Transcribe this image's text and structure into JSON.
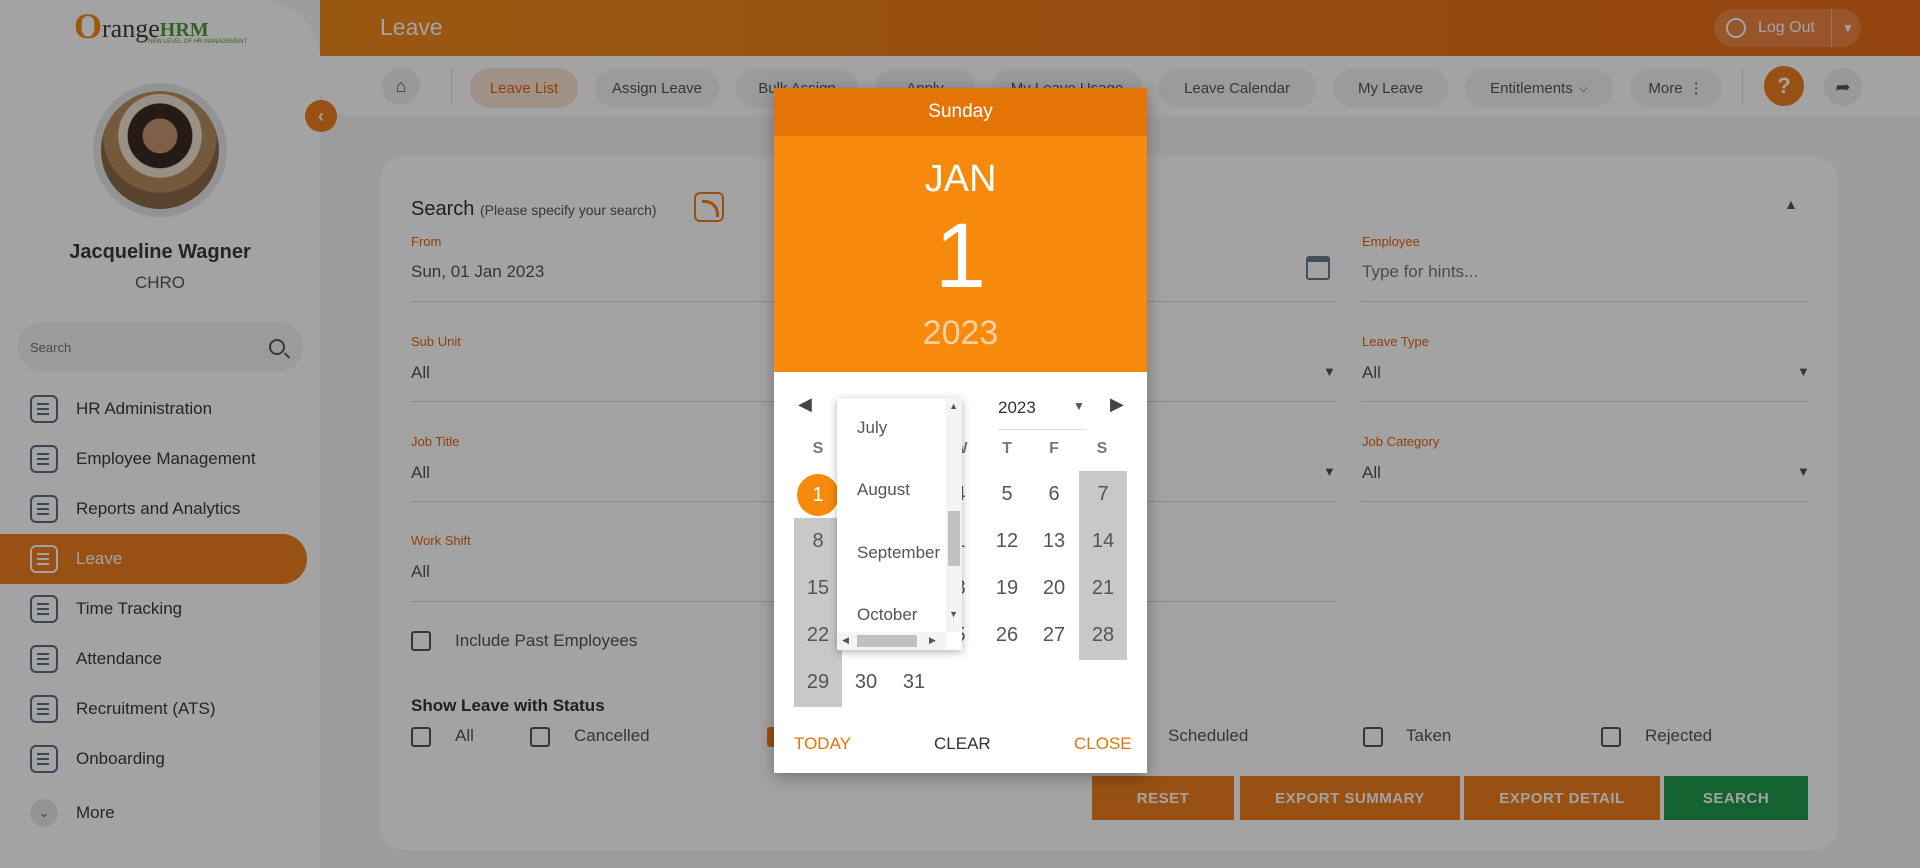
{
  "app": {
    "logo_o": "O",
    "logo_range": "range",
    "logo_hrm": "HRM",
    "logo_tagline": "NEW LEVEL OF HR MANAGEMENT",
    "page_title": "Leave",
    "logout_label": "Log Out",
    "brand_color": "#ef7d1f"
  },
  "user": {
    "name": "Jacqueline Wagner",
    "role": "CHRO"
  },
  "sidebar": {
    "search_placeholder": "Search",
    "items": [
      {
        "label": "HR Administration",
        "icon": "hr-admin-icon"
      },
      {
        "label": "Employee Management",
        "icon": "employees-icon"
      },
      {
        "label": "Reports and Analytics",
        "icon": "reports-icon"
      },
      {
        "label": "Leave",
        "icon": "leave-icon",
        "active": true
      },
      {
        "label": "Time Tracking",
        "icon": "clock-icon"
      },
      {
        "label": "Attendance",
        "icon": "attendance-icon"
      },
      {
        "label": "Recruitment (ATS)",
        "icon": "recruitment-icon"
      },
      {
        "label": "Onboarding",
        "icon": "handshake-icon"
      }
    ],
    "more_label": "More"
  },
  "nav": {
    "tabs": [
      {
        "label": "Leave List",
        "active": true
      },
      {
        "label": "Assign Leave"
      },
      {
        "label": "Bulk Assign"
      },
      {
        "label": "Apply"
      },
      {
        "label": "My Leave Usage"
      },
      {
        "label": "Leave Calendar"
      },
      {
        "label": "My Leave"
      },
      {
        "label": "Entitlements"
      },
      {
        "label": "More"
      }
    ],
    "help_label": "?"
  },
  "search": {
    "title": "Search",
    "subtitle": "(Please specify your search)",
    "from_label": "From",
    "from_value": "Sun, 01 Jan 2023",
    "employee_label": "Employee",
    "employee_placeholder": "Type for hints...",
    "subunit_label": "Sub Unit",
    "subunit_value": "All",
    "leave_type_label": "Leave Type",
    "leave_type_value": "All",
    "job_title_label": "Job Title",
    "job_title_value": "All",
    "job_category_label": "Job Category",
    "job_category_value": "All",
    "work_shift_label": "Work Shift",
    "work_shift_value": "All",
    "include_past_label": "Include Past Employees",
    "status_title": "Show Leave with Status",
    "statuses": [
      "All",
      "Cancelled",
      "Scheduled",
      "Taken",
      "Rejected"
    ]
  },
  "buttons": {
    "reset": "RESET",
    "export_summary": "EXPORT SUMMARY",
    "export_detail": "EXPORT DETAIL",
    "search": "SEARCH",
    "search_color": "#1e9a4a"
  },
  "datepicker": {
    "weekday": "Sunday",
    "month": "JAN",
    "day": "1",
    "year": "2023",
    "year_select": "2023",
    "dow": [
      "S",
      "W",
      "T",
      "F",
      "S"
    ],
    "rows": [
      [
        "1",
        "4",
        "5",
        "6",
        "7"
      ],
      [
        "8",
        "1",
        "12",
        "13",
        "14"
      ],
      [
        "15",
        "8",
        "19",
        "20",
        "21"
      ],
      [
        "22",
        "5",
        "26",
        "27",
        "28"
      ],
      [
        "29",
        "30",
        "31"
      ]
    ],
    "month_options": [
      "July",
      "August",
      "September",
      "October"
    ],
    "today_label": "TODAY",
    "clear_label": "CLEAR",
    "close_label": "CLOSE"
  }
}
